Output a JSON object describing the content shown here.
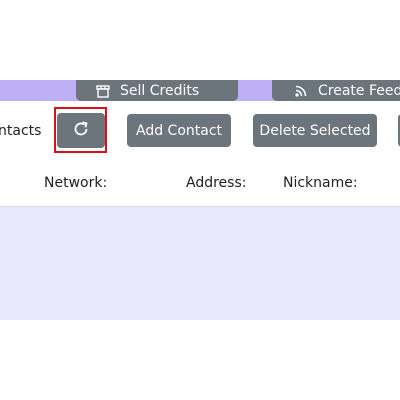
{
  "top_buttons": {
    "sell_credits": {
      "label": "Sell Credits",
      "icon": "store-icon"
    },
    "create_feed": {
      "label": "Create Feed",
      "icon": "rss-icon"
    }
  },
  "toolbar": {
    "section_label": "ntacts",
    "refresh_icon": "refresh-icon",
    "add_contact_label": "Add Contact",
    "delete_selected_label": "Delete Selected"
  },
  "table": {
    "columns": [
      "Network:",
      "Address:",
      "Nickname:"
    ],
    "rows": []
  },
  "colors": {
    "band": "#bdb0f5",
    "button": "#6c747c",
    "table_body": "#e9e8fd",
    "focus_ring": "#d8111b"
  }
}
